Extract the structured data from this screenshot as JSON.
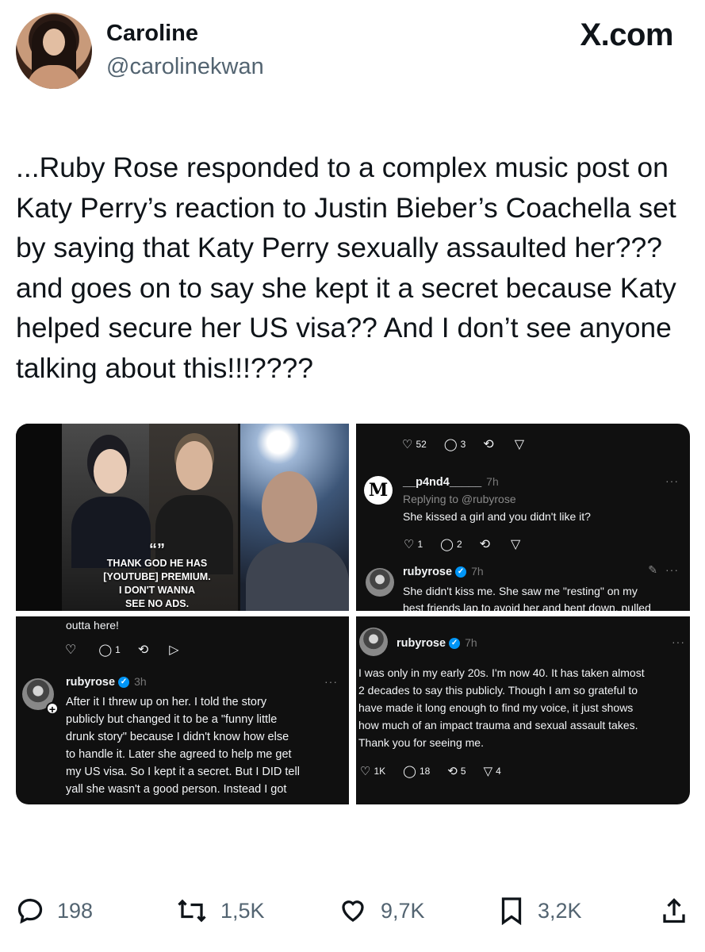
{
  "author": {
    "name": "Caroline",
    "handle": "@carolinekwan",
    "site_label": "X.com"
  },
  "tweet_text": "...Ruby Rose responded to a complex music post on Katy Perry’s reaction to Justin Bieber’s Coachella set by saying that Katy Perry sexually assaulted her??? and goes on to say she kept it a secret because Katy helped secure her US visa?? And I don’t see anyone talking about this!!!????",
  "media": {
    "cell1": {
      "quote_mark": "“”",
      "caption_lines": [
        "THANK GOD HE HAS",
        "[YOUTUBE] PREMIUM.",
        "I DON'T WANNA",
        "SEE NO ADS."
      ]
    },
    "cell2": {
      "top_stats": {
        "likes": "52",
        "replies": "3"
      },
      "reply": {
        "username": "__p4nd4_____",
        "time": "7h",
        "replying_to": "Replying to @rubyrose",
        "text": "She kissed a girl and you didn't like it?",
        "likes": "1",
        "replies": "2"
      },
      "ruby": {
        "username": "rubyrose",
        "time": "7h",
        "text_1": "She didn't kiss me. She saw me \"resting\" on my",
        "text_2": "best friends lap to avoid her and bent down, pulled"
      }
    },
    "cell3": {
      "top_text": "outta here!",
      "replies": "1",
      "username": "rubyrose",
      "time": "3h",
      "lines": [
        "After it I threw up on her. I told the story",
        "publicly but changed it to be a \"funny little",
        "drunk story\" because I didn't know how else",
        "to handle it. Later she agreed to help me get",
        "my US visa. So I kept it a secret. But I DID tell",
        "yall she wasn't a good person. Instead I got"
      ]
    },
    "cell4": {
      "username": "rubyrose",
      "time": "7h",
      "lines": [
        "I was only in my early 20s. I'm now 40. It has taken almost",
        "2 decades to say this publicly. Though I am so grateful to",
        "have made it long enough to find my voice, it just shows",
        "how much of an impact trauma and sexual assault takes.",
        "Thank you for seeing me."
      ],
      "stats": {
        "likes": "1K",
        "replies": "18",
        "reposts": "5",
        "shares": "4"
      }
    }
  },
  "actions": {
    "replies": "198",
    "reposts": "1,5K",
    "likes": "9,7K",
    "bookmarks": "3,2K"
  }
}
